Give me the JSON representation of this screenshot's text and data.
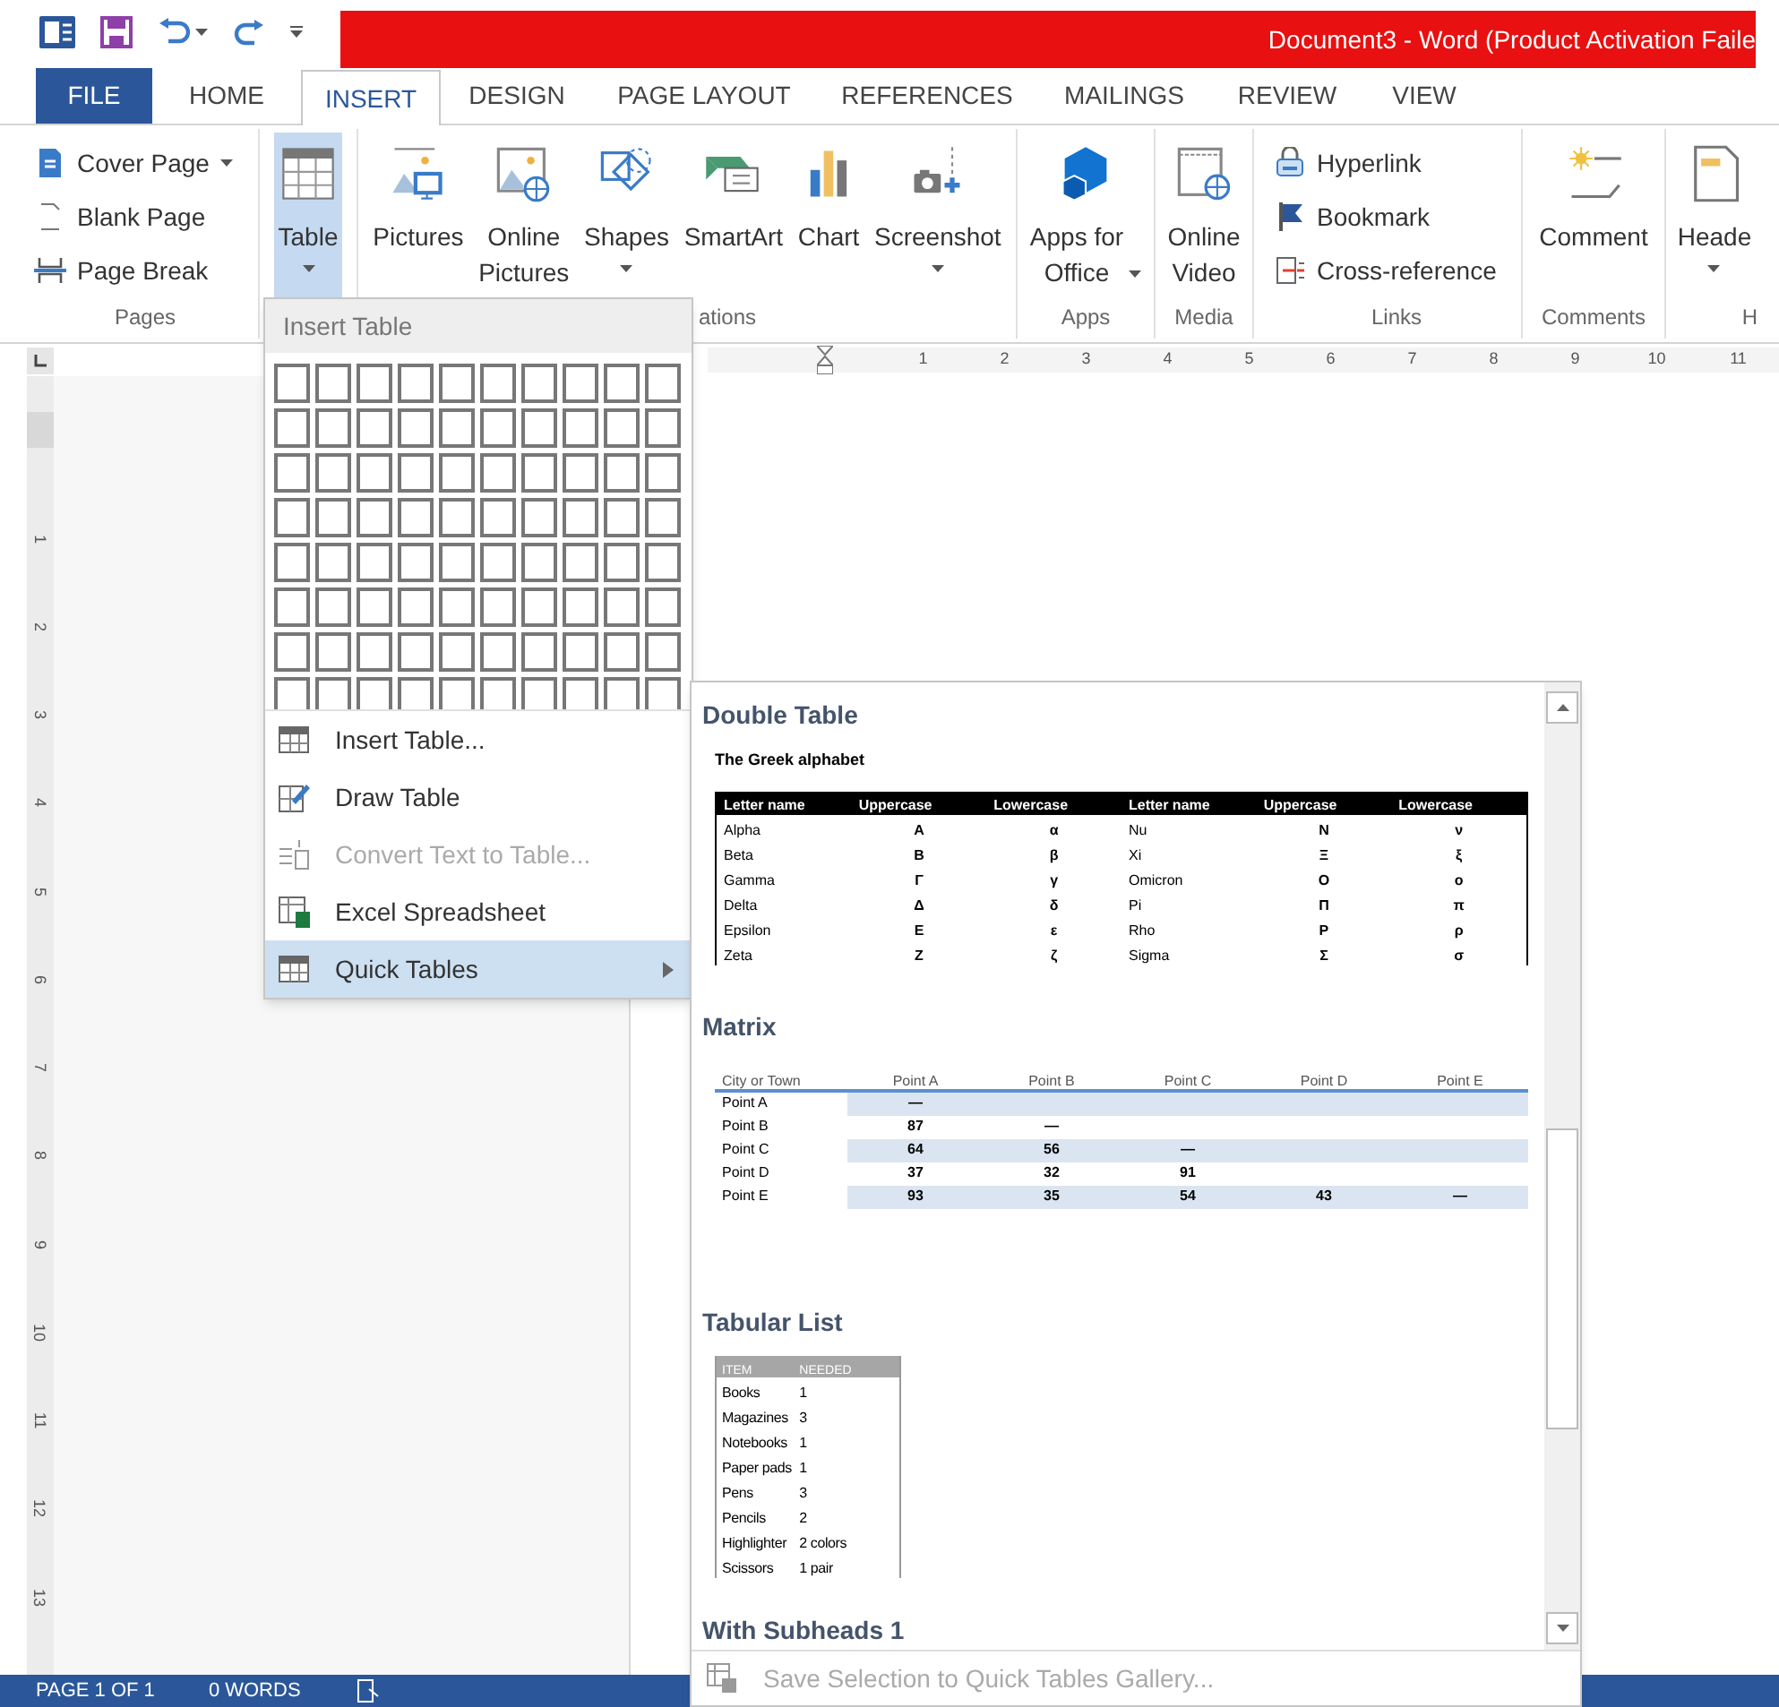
{
  "title_bar": {
    "title": "Document3 - Word (Product Activation Faile"
  },
  "tabs": [
    {
      "label": "FILE",
      "kind": "file",
      "selected": false
    },
    {
      "label": "HOME",
      "kind": "tab",
      "selected": false
    },
    {
      "label": "INSERT",
      "kind": "tab",
      "selected": true
    },
    {
      "label": "DESIGN",
      "kind": "tab",
      "selected": false
    },
    {
      "label": "PAGE LAYOUT",
      "kind": "tab",
      "selected": false
    },
    {
      "label": "REFERENCES",
      "kind": "tab",
      "selected": false
    },
    {
      "label": "MAILINGS",
      "kind": "tab",
      "selected": false
    },
    {
      "label": "REVIEW",
      "kind": "tab",
      "selected": false
    },
    {
      "label": "VIEW",
      "kind": "tab",
      "selected": false
    }
  ],
  "ribbon": {
    "groups": [
      {
        "label": "Pages",
        "buttons": [
          {
            "kind": "small",
            "label": "Cover Page",
            "dropdown": true,
            "pressed": false
          },
          {
            "kind": "small",
            "label": "Blank Page",
            "dropdown": false,
            "pressed": false
          },
          {
            "kind": "small",
            "label": "Page Break",
            "dropdown": false,
            "pressed": false
          }
        ]
      },
      {
        "buttons": [
          {
            "kind": "large",
            "lines": [
              "Table"
            ],
            "dropdown": true,
            "pressed": true
          }
        ]
      },
      {
        "label": "ations",
        "buttons": [
          {
            "kind": "large",
            "lines": [
              "Pictures"
            ],
            "dropdown": false,
            "pressed": false
          },
          {
            "kind": "large",
            "lines": [
              "Online",
              "Pictures"
            ],
            "dropdown": false,
            "pressed": false
          },
          {
            "kind": "large",
            "lines": [
              "Shapes"
            ],
            "dropdown": true,
            "pressed": false
          },
          {
            "kind": "large",
            "lines": [
              "SmartArt"
            ],
            "dropdown": false,
            "pressed": false
          },
          {
            "kind": "large",
            "lines": [
              "Chart"
            ],
            "dropdown": false,
            "pressed": false
          },
          {
            "kind": "large",
            "lines": [
              "Screenshot"
            ],
            "dropdown": true,
            "pressed": false
          }
        ]
      },
      {
        "label": "Apps",
        "buttons": [
          {
            "kind": "large",
            "lines": [
              "Apps for",
              "Office"
            ],
            "dropdown": true,
            "pressed": false
          }
        ]
      },
      {
        "label": "Media",
        "buttons": [
          {
            "kind": "large",
            "lines": [
              "Online",
              "Video"
            ],
            "dropdown": false,
            "pressed": false
          }
        ]
      },
      {
        "label": "Links",
        "buttons": [
          {
            "kind": "small",
            "label": "Hyperlink",
            "dropdown": false,
            "pressed": false
          },
          {
            "kind": "small",
            "label": "Bookmark",
            "dropdown": false,
            "pressed": false
          },
          {
            "kind": "small",
            "label": "Cross-reference",
            "dropdown": false,
            "pressed": false
          }
        ]
      },
      {
        "label": "Comments",
        "buttons": [
          {
            "kind": "large",
            "lines": [
              "Comment"
            ],
            "dropdown": false,
            "pressed": false
          }
        ]
      },
      {
        "label": "H",
        "buttons": [
          {
            "kind": "large",
            "lines": [
              "Heade"
            ],
            "dropdown": true,
            "pressed": false
          }
        ]
      }
    ]
  },
  "ruler": {
    "numbers": [
      "1",
      "2",
      "3",
      "4",
      "5",
      "6",
      "7",
      "8",
      "9",
      "10",
      "11"
    ]
  },
  "vertical_ruler": {
    "numbers": [
      "1",
      "2",
      "3",
      "4",
      "5",
      "6",
      "7",
      "8",
      "9",
      "10",
      "11",
      "12",
      "13"
    ]
  },
  "table_menu": {
    "header": "Insert Table",
    "items": [
      {
        "label": "Insert Table...",
        "disabled": false,
        "selected": false,
        "submenu": false
      },
      {
        "label": "Draw Table",
        "disabled": false,
        "selected": false,
        "submenu": false
      },
      {
        "label": "Convert Text to Table...",
        "disabled": true,
        "selected": false,
        "submenu": false
      },
      {
        "label": "Excel Spreadsheet",
        "disabled": false,
        "selected": false,
        "submenu": false
      },
      {
        "label": "Quick Tables",
        "disabled": false,
        "selected": true,
        "submenu": true
      }
    ]
  },
  "quick_tables": {
    "sections": [
      {
        "kind": "double",
        "title": "Double Table",
        "caption": "The Greek alphabet",
        "columns": [
          "Letter name",
          "Uppercase",
          "Lowercase",
          "Letter name",
          "Uppercase",
          "Lowercase"
        ],
        "rows": [
          [
            "Alpha",
            "Α",
            "α",
            "Nu",
            "Ν",
            "ν"
          ],
          [
            "Beta",
            "Β",
            "β",
            "Xi",
            "Ξ",
            "ξ"
          ],
          [
            "Gamma",
            "Γ",
            "γ",
            "Omicron",
            "Ο",
            "ο"
          ],
          [
            "Delta",
            "Δ",
            "δ",
            "Pi",
            "Π",
            "π"
          ],
          [
            "Epsilon",
            "Ε",
            "ε",
            "Rho",
            "Ρ",
            "ρ"
          ],
          [
            "Zeta",
            "Ζ",
            "ζ",
            "Sigma",
            "Σ",
            "σ"
          ]
        ]
      },
      {
        "kind": "matrix",
        "title": "Matrix",
        "columns": [
          "City or Town",
          "Point A",
          "Point B",
          "Point C",
          "Point D",
          "Point E"
        ],
        "rows": [
          [
            "Point A",
            "—",
            "",
            "",
            "",
            ""
          ],
          [
            "Point B",
            "87",
            "—",
            "",
            "",
            ""
          ],
          [
            "Point C",
            "64",
            "56",
            "—",
            "",
            ""
          ],
          [
            "Point D",
            "37",
            "32",
            "91",
            "",
            ""
          ],
          [
            "Point E",
            "93",
            "35",
            "54",
            "43",
            "—"
          ]
        ]
      },
      {
        "kind": "list",
        "title": "Tabular List",
        "columns": [
          "ITEM",
          "NEEDED"
        ],
        "rows": [
          [
            "Books",
            "1"
          ],
          [
            "Magazines",
            "3"
          ],
          [
            "Notebooks",
            "1"
          ],
          [
            "Paper pads",
            "1"
          ],
          [
            "Pens",
            "3"
          ],
          [
            "Pencils",
            "2"
          ],
          [
            "Highlighter",
            "2 colors"
          ],
          [
            "Scissors",
            "1 pair"
          ]
        ]
      },
      {
        "kind": "heading",
        "title": "With Subheads 1"
      }
    ],
    "footer": {
      "label": "Save Selection to Quick Tables Gallery...",
      "disabled": true
    }
  },
  "status_bar": {
    "items": [
      "PAGE 1 OF 1",
      "0 WORDS"
    ]
  }
}
